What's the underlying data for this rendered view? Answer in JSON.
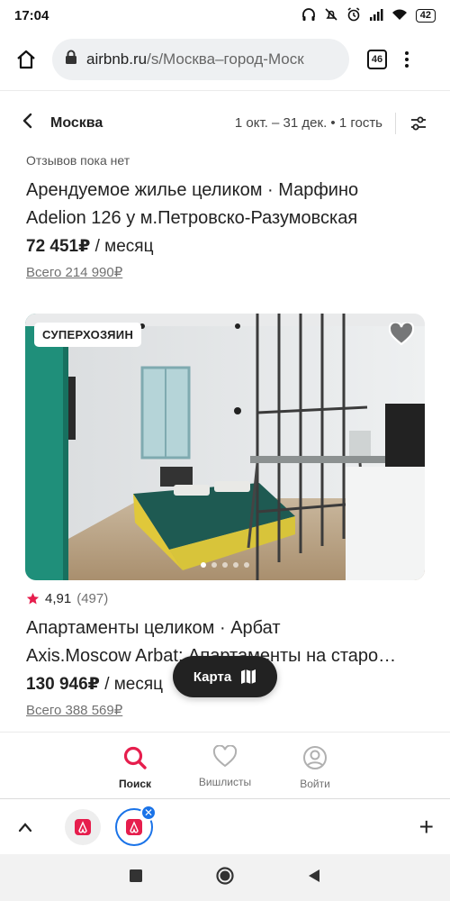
{
  "status_bar": {
    "time": "17:04",
    "battery": "42",
    "icons": [
      "headphones-icon",
      "mute-icon",
      "alarm-icon",
      "signal-icon",
      "wifi-icon"
    ]
  },
  "browser": {
    "url_domain": "airbnb.ru",
    "url_path": "/s/Москва–город-Моск",
    "tab_count": "46"
  },
  "search": {
    "city": "Москва",
    "summary": "1 окт. – 31 дек. • 1 гость"
  },
  "listings": [
    {
      "reviews": "Отзывов пока нет",
      "title_line1": "Арендуемое жилье целиком · Марфино",
      "title_line2": "Adelion 126 у м.Петровско-Разумовская",
      "price": "72 451₽",
      "price_suffix": "/ месяц",
      "total": "Всего 214 990₽"
    },
    {
      "badge": "СУПЕРХОЗЯИН",
      "rating": "4,91",
      "reviews_count": "(497)",
      "title_line1": "Апартаменты целиком · Арбат",
      "title_line2": "Axis.Moscow Arbat: Апартаменты на старо…",
      "price": "130 946₽",
      "price_suffix": "/ месяц",
      "total": "Всего 388 569₽",
      "photo_dots": 5,
      "photo_index": 1
    }
  ],
  "map_button": {
    "label": "Карта"
  },
  "bottom_nav": {
    "items": [
      {
        "label": "Поиск",
        "icon": "search-icon",
        "active": true
      },
      {
        "label": "Вишлисты",
        "icon": "heart-icon",
        "active": false
      },
      {
        "label": "Войти",
        "icon": "account-icon",
        "active": false
      }
    ]
  },
  "colors": {
    "accent": "#E61E4D",
    "text": "#222222",
    "muted": "#717171",
    "tab_selected": "#1A73E8"
  }
}
